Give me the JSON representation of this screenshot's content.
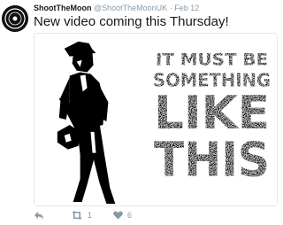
{
  "tweet": {
    "display_name": "ShootTheMoon",
    "handle": "@ShootTheMoonUK",
    "separator": "·",
    "date": "Feb 12",
    "text": "New video coming this Thursday!",
    "media": {
      "lines": [
        "IT MUST BE",
        "SOMETHING",
        "LIKE",
        "THIS"
      ]
    },
    "actions": {
      "reply_icon": "reply-icon",
      "retweet_icon": "retweet-icon",
      "retweet_count": "1",
      "like_icon": "heart-icon",
      "like_count": "6"
    },
    "colors": {
      "text": "#14171a",
      "secondary": "#8899a6",
      "border": "#e1e8ed"
    }
  }
}
